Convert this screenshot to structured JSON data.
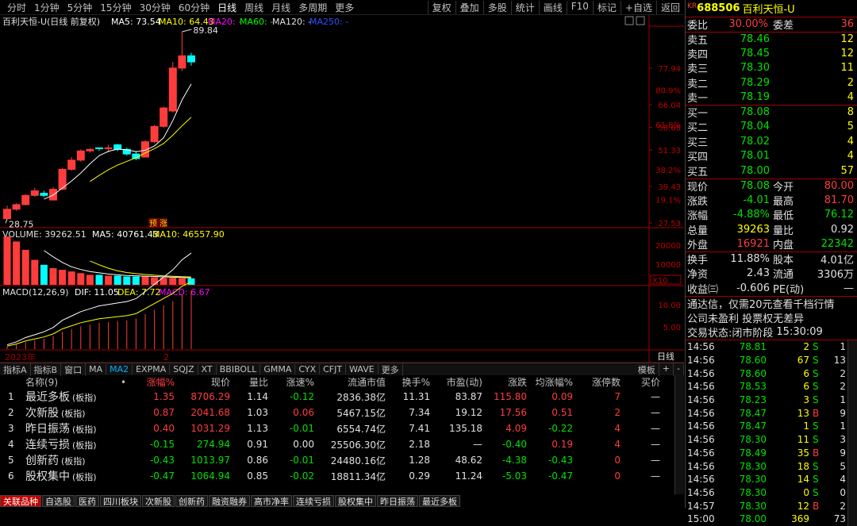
{
  "toolbar": {
    "periods": [
      "分时",
      "1分钟",
      "5分钟",
      "15分钟",
      "30分钟",
      "60分钟",
      "日线",
      "周线",
      "月线",
      "多周期",
      "更多"
    ],
    "active": "日线",
    "right": [
      "复权",
      "叠加",
      "多股",
      "统计",
      "画线",
      "F10",
      "标记",
      "+自选",
      "返回"
    ]
  },
  "main_chart": {
    "title": "百利天恒-U(日线 前复权)",
    "ma5": "MA5: 73.54",
    "ma10": "MA10: 64.43",
    "ma20": "MA20: -",
    "ma60": "MA60: -",
    "ma120": "MA120: -",
    "ma250": "MA250: -",
    "hi_label": "89.84",
    "lo_label": "28.75",
    "pre_tag": "预 涨",
    "y_prices": [
      "77.94",
      "66.04",
      "58.68",
      "51.33",
      "39.43",
      "27.53"
    ],
    "y_pcts": [
      "80.9%",
      "61.8%",
      "38.2%",
      "19.1%"
    ],
    "colors": {
      "up": "#ff3c3c",
      "down": "#00ffff",
      "ma5": "#ffffff",
      "ma10": "#ffff00"
    }
  },
  "chart_data": {
    "type": "candlestick",
    "candles": [
      [
        28.9,
        32.0,
        28.75,
        33.2
      ],
      [
        32.0,
        33.5,
        31.5,
        34.0
      ],
      [
        33.5,
        36.5,
        33.2,
        37.0
      ],
      [
        36.5,
        38.0,
        36.0,
        39.0
      ],
      [
        37.2,
        36.5,
        35.9,
        38.0
      ],
      [
        35.0,
        38.5,
        34.8,
        39.2
      ],
      [
        38.5,
        45.0,
        38.2,
        45.5
      ],
      [
        45.0,
        48.0,
        44.5,
        49.0
      ],
      [
        48.0,
        51.0,
        47.5,
        51.5
      ],
      [
        51.0,
        51.5,
        50.5,
        52.0
      ],
      [
        52.0,
        51.8,
        51.0,
        52.2
      ],
      [
        52.0,
        52.0,
        50.5,
        53.0
      ],
      [
        53.0,
        51.5,
        50.9,
        53.3
      ],
      [
        51.5,
        50.0,
        49.5,
        52.0
      ],
      [
        50.0,
        48.5,
        48.0,
        51.0
      ],
      [
        49.0,
        54.0,
        49.0,
        54.5
      ],
      [
        54.0,
        59.0,
        53.5,
        59.5
      ],
      [
        59.0,
        65.0,
        58.5,
        65.5
      ],
      [
        64.0,
        78.0,
        63.5,
        80.0
      ],
      [
        78.0,
        82.0,
        77.0,
        89.84
      ],
      [
        82.0,
        80.0,
        78.8,
        83.0
      ]
    ]
  },
  "volume": {
    "label": "VOLUME: 39262.51",
    "ma5": "MA5: 40761.43",
    "ma10": "MA10: 46557.90",
    "y_labels": [
      "20000",
      "10000",
      "X10"
    ],
    "bars": [
      2.9,
      2.6,
      2.1,
      1.5,
      1.2,
      1.0,
      0.9,
      0.8,
      0.7,
      0.6,
      0.6,
      0.55,
      0.55,
      0.5,
      0.5,
      0.5,
      0.45,
      0.42,
      0.42,
      0.4,
      0.39
    ]
  },
  "macd": {
    "label": "MACD(12,26,9)",
    "dif": "DIF: 11.05",
    "dea": "DEA: 7.72",
    "macd": "MACD: 6.67",
    "y_labels": [
      "10.00",
      "5.00"
    ],
    "year": "2023年",
    "mark": "2",
    "bars": [
      0.3,
      0.5,
      0.8,
      1.0,
      1.2,
      1.5,
      2.0,
      2.3,
      2.6,
      2.8,
      3.0,
      3.1,
      3.2,
      3.3,
      3.5,
      4.0,
      4.5,
      5.0,
      5.5,
      6.2,
      6.67
    ]
  },
  "daily_btn": "日线",
  "indicators": {
    "items": [
      "指标A",
      "指标B",
      "窗口",
      "MA",
      "MA2",
      "EXPMA",
      "SQJZ",
      "XT",
      "BBIBOLL",
      "GMMA",
      "CYX",
      "CFJT",
      "WAVE",
      "更多"
    ],
    "active": "MA2",
    "right": [
      "模板",
      "+",
      "-"
    ]
  },
  "table": {
    "headers": [
      "名称(9)",
      "•",
      "涨幅%",
      "现价",
      "量比",
      "涨速%",
      "流通市值",
      "换手%",
      "市盈(动)",
      "涨跌",
      "均涨幅%",
      "涨停数",
      "买价"
    ],
    "rows": [
      {
        "no": "1",
        "name": "最近多板",
        "tag": "(板指)",
        "chg": "1.35",
        "price": "8706.29",
        "vr": "1.14",
        "spd": "-0.12",
        "cap": "2836.38亿",
        "turn": "11.31",
        "pe": "83.87",
        "diff": "115.80",
        "avg": "0.09",
        "lim": "7",
        "bid": "—"
      },
      {
        "no": "2",
        "name": "次新股",
        "tag": "(板指)",
        "chg": "0.87",
        "price": "2041.68",
        "vr": "1.03",
        "spd": "0.06",
        "cap": "5467.15亿",
        "turn": "7.34",
        "pe": "19.12",
        "diff": "17.56",
        "avg": "0.51",
        "lim": "2",
        "bid": "—"
      },
      {
        "no": "3",
        "name": "昨日振荡",
        "tag": "(板指)",
        "chg": "0.40",
        "price": "1031.29",
        "vr": "1.13",
        "spd": "-0.01",
        "cap": "6554.74亿",
        "turn": "7.41",
        "pe": "135.18",
        "diff": "4.09",
        "avg": "-0.22",
        "lim": "4",
        "bid": "—"
      },
      {
        "no": "4",
        "name": "连续亏损",
        "tag": "(板指)",
        "chg": "-0.15",
        "price": "274.94",
        "vr": "0.91",
        "spd": "0.00",
        "cap": "25506.30亿",
        "turn": "2.18",
        "pe": "—",
        "diff": "-0.40",
        "avg": "0.19",
        "lim": "4",
        "bid": "—"
      },
      {
        "no": "5",
        "name": "创新药",
        "tag": "(板指)",
        "chg": "-0.43",
        "price": "1013.97",
        "vr": "0.86",
        "spd": "-0.01",
        "cap": "24480.16亿",
        "turn": "1.28",
        "pe": "48.62",
        "diff": "-4.38",
        "avg": "-0.43",
        "lim": "0",
        "bid": "—"
      },
      {
        "no": "6",
        "name": "股权集中",
        "tag": "(板指)",
        "chg": "-0.47",
        "price": "1064.94",
        "vr": "0.85",
        "spd": "-0.02",
        "cap": "18811.34亿",
        "turn": "0.29",
        "pe": "11.24",
        "diff": "-5.03",
        "avg": "-0.47",
        "lim": "0",
        "bid": "—"
      }
    ]
  },
  "bottom_tabs": [
    "关联品种",
    "自选股",
    "医药",
    "四川板块",
    "次新股",
    "创新药",
    "融资融券",
    "高市净率",
    "连续亏损",
    "股权集中",
    "昨日振荡",
    "最近多板"
  ],
  "panel": {
    "kr": "KR",
    "code": "688506",
    "name": "百利天恒-U",
    "weibi_l": "委比",
    "weibi": "30.00%",
    "weicha_l": "委差",
    "weicha": "36",
    "asks": [
      {
        "l": "卖五",
        "p": "78.46",
        "v": "12"
      },
      {
        "l": "卖四",
        "p": "78.45",
        "v": "12"
      },
      {
        "l": "卖三",
        "p": "78.30",
        "v": "11"
      },
      {
        "l": "卖二",
        "p": "78.29",
        "v": "2"
      },
      {
        "l": "卖一",
        "p": "78.19",
        "v": "4"
      }
    ],
    "bids": [
      {
        "l": "买一",
        "p": "78.08",
        "v": "8"
      },
      {
        "l": "买二",
        "p": "78.04",
        "v": "5"
      },
      {
        "l": "买三",
        "p": "78.02",
        "v": "4"
      },
      {
        "l": "买四",
        "p": "78.01",
        "v": "4"
      },
      {
        "l": "买五",
        "p": "78.00",
        "v": "57"
      }
    ],
    "q": [
      [
        "现价",
        "78.08",
        "今开",
        "80.00"
      ],
      [
        "涨跌",
        "-4.01",
        "最高",
        "81.70"
      ],
      [
        "涨幅",
        "-4.88%",
        "最低",
        "76.12"
      ],
      [
        "总量",
        "39263",
        "量比",
        "0.92"
      ],
      [
        "外盘",
        "16921",
        "内盘",
        "22342"
      ]
    ],
    "q2": [
      [
        "换手",
        "11.88%",
        "股本",
        "4.01亿"
      ],
      [
        "净资",
        "2.43",
        "流通",
        "3306万"
      ],
      [
        "收益㈢",
        "-0.606",
        "PE(动)",
        "—"
      ]
    ],
    "notice1": "通达信，仅需20元查看千档行情",
    "notice2": "公司未盈利 投票权无差异",
    "status_l": "交易状态:",
    "status": "闭市阶段",
    "status_t": "15:30:09",
    "ticks": [
      [
        "14:56",
        "78.81",
        "2",
        "S",
        "1"
      ],
      [
        "14:56",
        "78.60",
        "67",
        "S",
        "13"
      ],
      [
        "14:56",
        "78.60",
        "6",
        "S",
        "2"
      ],
      [
        "14:56",
        "78.53",
        "6",
        "S",
        "2"
      ],
      [
        "14:56",
        "78.23",
        "3",
        "S",
        "1"
      ],
      [
        "14:56",
        "78.47",
        "13",
        "B",
        "9"
      ],
      [
        "14:56",
        "78.47",
        "1",
        "S",
        "1"
      ],
      [
        "14:56",
        "78.30",
        "11",
        "S",
        "3"
      ],
      [
        "14:56",
        "78.49",
        "35",
        "B",
        "9"
      ],
      [
        "14:56",
        "78.30",
        "18",
        "S",
        "5"
      ],
      [
        "14:56",
        "78.30",
        "14",
        "S",
        "4"
      ],
      [
        "14:56",
        "78.30",
        "0",
        "S",
        "0"
      ],
      [
        "14:57",
        "78.30",
        "12",
        "B",
        "2"
      ],
      [
        "15:00",
        "78.00",
        "369",
        "",
        "73"
      ]
    ]
  }
}
